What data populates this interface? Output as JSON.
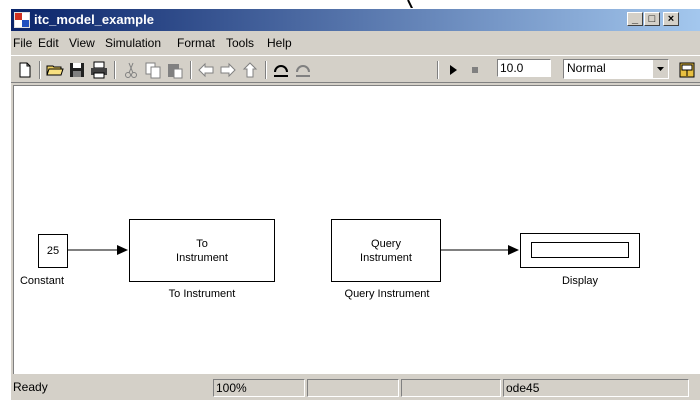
{
  "window": {
    "title": "itc_model_example"
  },
  "menubar": {
    "items": [
      "File",
      "Edit",
      "View",
      "Simulation",
      "Format",
      "Tools",
      "Help"
    ]
  },
  "toolbar": {
    "buttons": [
      "new-file-icon",
      "open-folder-icon",
      "save-icon",
      "print-icon",
      "cut-icon",
      "copy-icon",
      "paste-icon",
      "back-arrow-icon",
      "forward-arrow-icon",
      "up-arrow-icon",
      "undo-icon",
      "redo-icon",
      "run-icon",
      "stop-icon",
      "library-browser-icon"
    ],
    "stop_time": "10.0",
    "sim_mode": "Normal"
  },
  "blocks": {
    "constant": {
      "value": "25",
      "label": "Constant"
    },
    "to_instrument": {
      "text_line1": "To",
      "text_line2": "Instrument",
      "label": "To Instrument"
    },
    "query_instrument": {
      "text_line1": "Query",
      "text_line2": "Instrument",
      "label": "Query Instrument"
    },
    "display": {
      "label": "Display"
    }
  },
  "statusbar": {
    "status": "Ready",
    "zoom": "100%",
    "solver": "ode45"
  },
  "colors": {
    "title_start": "#0a246a",
    "title_end": "#a6caf0",
    "chrome": "#d4d0c8",
    "canvas": "#ffffff"
  }
}
